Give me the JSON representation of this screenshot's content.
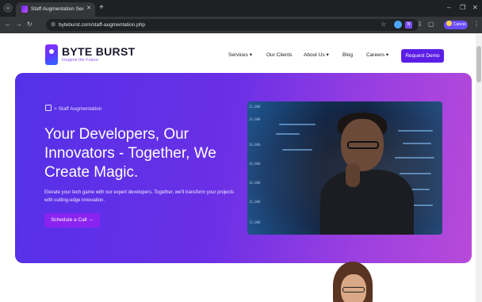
{
  "browser": {
    "tab_title": "Staff Augmentation Services - Byte Burst",
    "tab_close": "✕",
    "new_tab": "+",
    "url": "byteburst.com/staff-augmentation.php",
    "profile_label": "Cancel",
    "window_controls": [
      "–",
      "❐",
      "✕"
    ]
  },
  "site": {
    "logo_name": "BYTE BURST",
    "logo_tagline": "Imagine the Future",
    "nav": {
      "services": "Services ▾",
      "clients": "Our Clients",
      "about": "About Us ▾",
      "blog": "Blog",
      "careers": "Careers ▾",
      "demo": "Request Demo"
    }
  },
  "hero": {
    "breadcrumb": "> Staff Augmentation",
    "title": "Your Developers, Our Innovators - Together, We Create Magic.",
    "subtitle": "Elevate your tech game with our expert developers. Together, we'll transform your projects with cutting-edge innovation.",
    "cta": "Schedule a Call →",
    "photo_labels": [
      "25,000",
      "24,000",
      "20,000",
      "18,000",
      "16,000",
      "14,000",
      "12,000"
    ]
  },
  "colors": {
    "accent": "#5b1ee6",
    "hero_start": "#5431e8",
    "hero_end": "#b84ad9"
  }
}
